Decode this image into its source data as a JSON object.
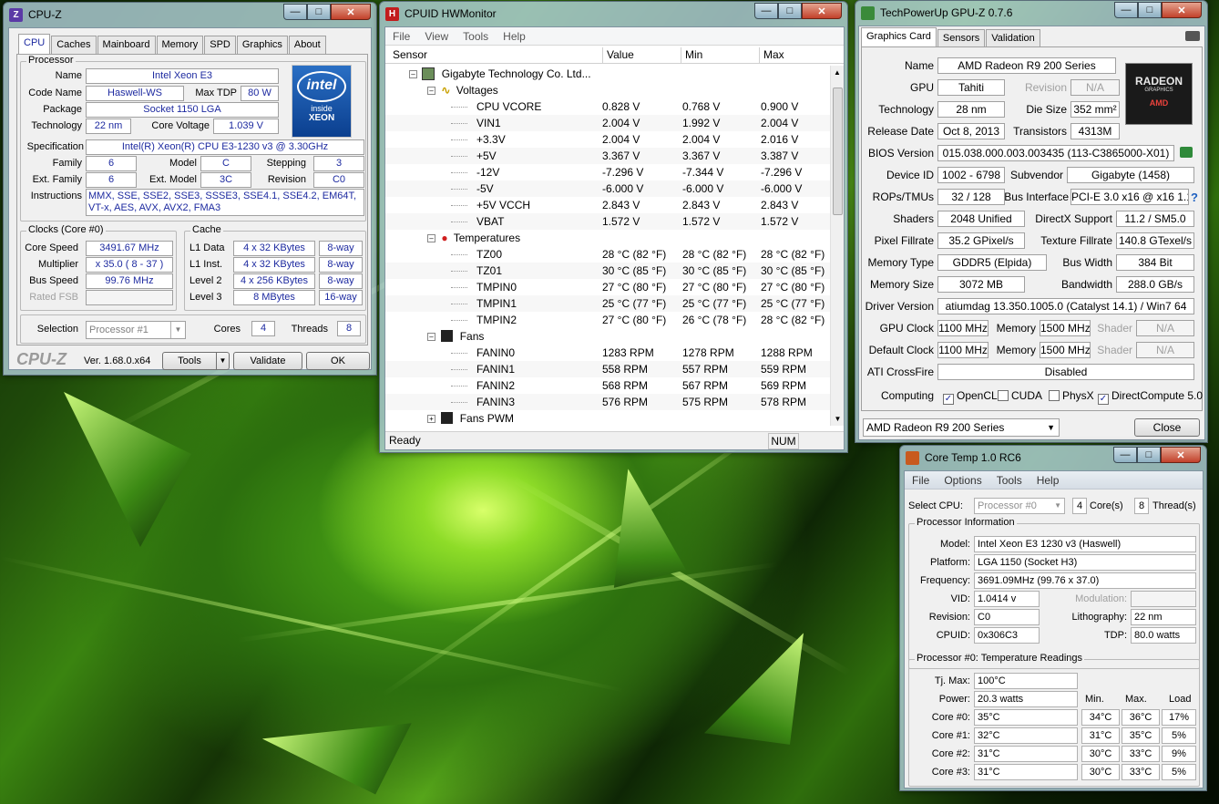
{
  "cpuz": {
    "title": "CPU-Z",
    "tabs": [
      "CPU",
      "Caches",
      "Mainboard",
      "Memory",
      "SPD",
      "Graphics",
      "About"
    ],
    "processor_group": "Processor",
    "name_label": "Name",
    "name": "Intel Xeon E3",
    "codename_label": "Code Name",
    "codename": "Haswell-WS",
    "maxtdp_label": "Max TDP",
    "maxtdp": "80 W",
    "package_label": "Package",
    "package": "Socket 1150 LGA",
    "tech_label": "Technology",
    "tech": "22 nm",
    "corevolt_label": "Core Voltage",
    "corevolt": "1.039 V",
    "spec_label": "Specification",
    "spec": "Intel(R) Xeon(R) CPU E3-1230 v3 @ 3.30GHz",
    "family_label": "Family",
    "family": "6",
    "model_label": "Model",
    "model": "C",
    "stepping_label": "Stepping",
    "stepping": "3",
    "extfamily_label": "Ext. Family",
    "extfamily": "6",
    "extmodel_label": "Ext. Model",
    "extmodel": "3C",
    "revision_label": "Revision",
    "revision": "C0",
    "instr_label": "Instructions",
    "instr1": "MMX, SSE, SSE2, SSE3, SSSE3, SSE4.1, SSE4.2, EM64T,",
    "instr2": "VT-x, AES, AVX, AVX2, FMA3",
    "logo_intel": "intel",
    "logo_inside": "inside",
    "logo_xeon": "XEON",
    "clocks_group": "Clocks (Core #0)",
    "corespeed_label": "Core Speed",
    "corespeed": "3491.67 MHz",
    "multiplier_label": "Multiplier",
    "multiplier": "x 35.0 ( 8 - 37 )",
    "busspeed_label": "Bus Speed",
    "busspeed": "99.76 MHz",
    "ratedfsb_label": "Rated FSB",
    "cache_group": "Cache",
    "l1d_label": "L1 Data",
    "l1d": "4 x 32 KBytes",
    "l1d_way": "8-way",
    "l1i_label": "L1 Inst.",
    "l1i": "4 x 32 KBytes",
    "l1i_way": "8-way",
    "l2_label": "Level 2",
    "l2": "4 x 256 KBytes",
    "l2_way": "8-way",
    "l3_label": "Level 3",
    "l3": "8 MBytes",
    "l3_way": "16-way",
    "selection_label": "Selection",
    "selection": "Processor #1",
    "cores_label": "Cores",
    "cores": "4",
    "threads_label": "Threads",
    "threads": "8",
    "brand": "CPU-Z",
    "version": "Ver. 1.68.0.x64",
    "tools": "Tools",
    "validate": "Validate",
    "ok": "OK"
  },
  "hwmon": {
    "title": "CPUID HWMonitor",
    "menu": [
      "File",
      "View",
      "Tools",
      "Help"
    ],
    "headers": [
      "Sensor",
      "Value",
      "Min",
      "Max"
    ],
    "board": "Gigabyte Technology Co. Ltd...",
    "voltages_label": "Voltages",
    "voltages": [
      [
        "CPU VCORE",
        "0.828 V",
        "0.768 V",
        "0.900 V"
      ],
      [
        "VIN1",
        "2.004 V",
        "1.992 V",
        "2.004 V"
      ],
      [
        "+3.3V",
        "2.004 V",
        "2.004 V",
        "2.016 V"
      ],
      [
        "+5V",
        "3.367 V",
        "3.367 V",
        "3.387 V"
      ],
      [
        "-12V",
        "-7.296 V",
        "-7.344 V",
        "-7.296 V"
      ],
      [
        "-5V",
        "-6.000 V",
        "-6.000 V",
        "-6.000 V"
      ],
      [
        "+5V VCCH",
        "2.843 V",
        "2.843 V",
        "2.843 V"
      ],
      [
        "VBAT",
        "1.572 V",
        "1.572 V",
        "1.572 V"
      ]
    ],
    "temps_label": "Temperatures",
    "temps": [
      [
        "TZ00",
        "28 °C  (82 °F)",
        "28 °C  (82 °F)",
        "28 °C  (82 °F)"
      ],
      [
        "TZ01",
        "30 °C  (85 °F)",
        "30 °C  (85 °F)",
        "30 °C  (85 °F)"
      ],
      [
        "TMPIN0",
        "27 °C  (80 °F)",
        "27 °C  (80 °F)",
        "27 °C  (80 °F)"
      ],
      [
        "TMPIN1",
        "25 °C  (77 °F)",
        "25 °C  (77 °F)",
        "25 °C  (77 °F)"
      ],
      [
        "TMPIN2",
        "27 °C  (80 °F)",
        "26 °C  (78 °F)",
        "28 °C  (82 °F)"
      ]
    ],
    "fans_label": "Fans",
    "fans": [
      [
        "FANIN0",
        "1283 RPM",
        "1278 RPM",
        "1288 RPM"
      ],
      [
        "FANIN1",
        "558 RPM",
        "557 RPM",
        "559 RPM"
      ],
      [
        "FANIN2",
        "568 RPM",
        "567 RPM",
        "569 RPM"
      ],
      [
        "FANIN3",
        "576 RPM",
        "575 RPM",
        "578 RPM"
      ]
    ],
    "fanspwm_label": "Fans PWM",
    "status": "Ready",
    "num": "NUM"
  },
  "gpuz": {
    "title": "TechPowerUp GPU-Z 0.7.6",
    "tabs": [
      "Graphics Card",
      "Sensors",
      "Validation"
    ],
    "name_label": "Name",
    "name": "AMD Radeon R9 200 Series",
    "gpu_label": "GPU",
    "gpu": "Tahiti",
    "revision_label": "Revision",
    "revision": "N/A",
    "tech_label": "Technology",
    "tech": "28 nm",
    "diesize_label": "Die Size",
    "diesize": "352 mm²",
    "release_label": "Release Date",
    "release": "Oct 8, 2013",
    "transistors_label": "Transistors",
    "transistors": "4313M",
    "bios_label": "BIOS Version",
    "bios": "015.038.000.003.003435 (113-C3865000-X01)",
    "devid_label": "Device ID",
    "devid": "1002 - 6798",
    "subvendor_label": "Subvendor",
    "subvendor": "Gigabyte (1458)",
    "rops_label": "ROPs/TMUs",
    "rops": "32 / 128",
    "bus_label": "Bus Interface",
    "bus": "PCI-E 3.0 x16 @ x16 1.1",
    "shaders_label": "Shaders",
    "shaders": "2048 Unified",
    "dx_label": "DirectX Support",
    "dx": "11.2 / SM5.0",
    "pixel_label": "Pixel Fillrate",
    "pixel": "35.2 GPixel/s",
    "texture_label": "Texture Fillrate",
    "texture": "140.8 GTexel/s",
    "memtype_label": "Memory Type",
    "memtype": "GDDR5 (Elpida)",
    "buswidth_label": "Bus Width",
    "buswidth": "384 Bit",
    "memsize_label": "Memory Size",
    "memsize": "3072 MB",
    "bandwidth_label": "Bandwidth",
    "bandwidth": "288.0 GB/s",
    "driver_label": "Driver Version",
    "driver": "atiumdag 13.350.1005.0 (Catalyst 14.1) / Win7 64",
    "gpuclock_label": "GPU Clock",
    "gpuclock": "1100 MHz",
    "memory_label": "Memory",
    "memclock": "1500 MHz",
    "shader_label": "Shader",
    "shader": "N/A",
    "defclock_label": "Default Clock",
    "defclock": "1100 MHz",
    "defmem": "1500 MHz",
    "defshader": "N/A",
    "crossfire_label": "ATI CrossFire",
    "crossfire": "Disabled",
    "computing_label": "Computing",
    "opencl": "OpenCL",
    "cuda": "CUDA",
    "physx": "PhysX",
    "dcompute": "DirectCompute 5.0",
    "card_select": "AMD Radeon R9 200 Series",
    "close": "Close",
    "logo1": "RADEON",
    "logo2": "GRAPHICS",
    "logo3": "AMD"
  },
  "coretemp": {
    "title": "Core Temp 1.0 RC6",
    "menu": [
      "File",
      "Options",
      "Tools",
      "Help"
    ],
    "selectcpu_label": "Select CPU:",
    "selectcpu": "Processor #0",
    "cores": "4",
    "cores_label": "Core(s)",
    "threads": "8",
    "threads_label": "Thread(s)",
    "procinfo_label": "Processor Information",
    "model_label": "Model:",
    "model": "Intel Xeon E3 1230 v3 (Haswell)",
    "platform_label": "Platform:",
    "platform": "LGA 1150 (Socket H3)",
    "freq_label": "Frequency:",
    "freq": "3691.09MHz (99.76 x 37.0)",
    "vid_label": "VID:",
    "vid": "1.0414 v",
    "modulation_label": "Modulation:",
    "revision_label": "Revision:",
    "revision": "C0",
    "litho_label": "Lithography:",
    "litho": "22 nm",
    "cpuid_label": "CPUID:",
    "cpuid": "0x306C3",
    "tdp_label": "TDP:",
    "tdp": "80.0 watts",
    "temps_label": "Processor #0: Temperature Readings",
    "tjmax_label": "Tj. Max:",
    "tjmax": "100°C",
    "power_label": "Power:",
    "power": "20.3 watts",
    "col_min": "Min.",
    "col_max": "Max.",
    "col_load": "Load",
    "cores_rows": [
      [
        "Core #0:",
        "35°C",
        "34°C",
        "36°C",
        "17%"
      ],
      [
        "Core #1:",
        "32°C",
        "31°C",
        "35°C",
        "5%"
      ],
      [
        "Core #2:",
        "31°C",
        "30°C",
        "33°C",
        "9%"
      ],
      [
        "Core #3:",
        "31°C",
        "30°C",
        "33°C",
        "5%"
      ]
    ]
  }
}
